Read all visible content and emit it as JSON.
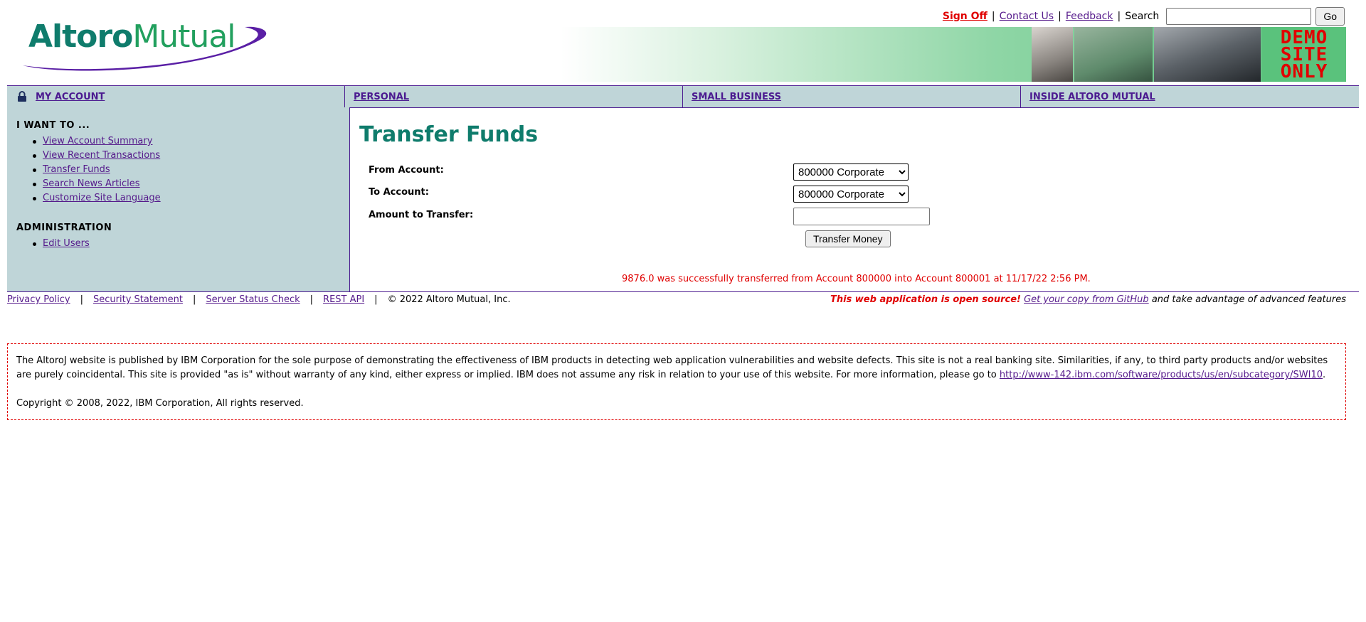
{
  "brand": {
    "logo_text_1": "Altoro",
    "logo_text_2": "Mutual"
  },
  "colors": {
    "brand_teal": "#0f7c6c",
    "nav_bg": "#bfd5d8",
    "accent_purple": "#4b1a90",
    "alert_red": "#e00000"
  },
  "top_links": {
    "signoff": "Sign Off",
    "contact": "Contact Us",
    "feedback": "Feedback",
    "search_label": "Search",
    "search_value": "",
    "go": "Go",
    "sep": "|"
  },
  "banner": {
    "demo_line1": "DEMO",
    "demo_line2": "SITE",
    "demo_line3": "ONLY"
  },
  "nav": {
    "my_account": "MY ACCOUNT",
    "personal": "PERSONAL",
    "small_business": "SMALL BUSINESS",
    "inside": "INSIDE ALTORO MUTUAL"
  },
  "sidebar": {
    "heading_iwant": "I WANT TO ...",
    "items": [
      {
        "label": "View Account Summary"
      },
      {
        "label": "View Recent Transactions"
      },
      {
        "label": "Transfer Funds"
      },
      {
        "label": "Search News Articles"
      },
      {
        "label": "Customize Site Language"
      }
    ],
    "heading_admin": "ADMINISTRATION",
    "admin_items": [
      {
        "label": "Edit Users"
      }
    ]
  },
  "main": {
    "title": "Transfer Funds",
    "from_label": "From Account:",
    "to_label": "To Account:",
    "amount_label": "Amount to Transfer:",
    "from_selected": "800000 Corporate",
    "to_selected": "800000 Corporate",
    "amount_value": "",
    "button": "Transfer Money",
    "result": "9876.0 was successfully transferred from Account 800000 into Account 800001 at 11/17/22 2:56 PM."
  },
  "footer": {
    "privacy": "Privacy Policy",
    "security": "Security Statement",
    "status": "Server Status Check",
    "rest": "REST API",
    "copyright": "© 2022 Altoro Mutual, Inc.",
    "sep": "|",
    "open_source_hl": "This web application is open source!",
    "github_link": "Get your copy from GitHub",
    "open_source_tail": "and take advantage of advanced features"
  },
  "disclaimer": {
    "text": "The AltoroJ website is published by IBM Corporation for the sole purpose of demonstrating the effectiveness of IBM products in detecting web application vulnerabilities and website defects. This site is not a real banking site. Similarities, if any, to third party products and/or websites are purely coincidental. This site is provided \"as is\" without warranty of any kind, either express or implied. IBM does not assume any risk in relation to your use of this website. For more information, please go to",
    "link": "http://www-142.ibm.com/software/products/us/en/subcategory/SWI10",
    "period": ".",
    "copyright": "Copyright © 2008, 2022, IBM Corporation, All rights reserved."
  }
}
